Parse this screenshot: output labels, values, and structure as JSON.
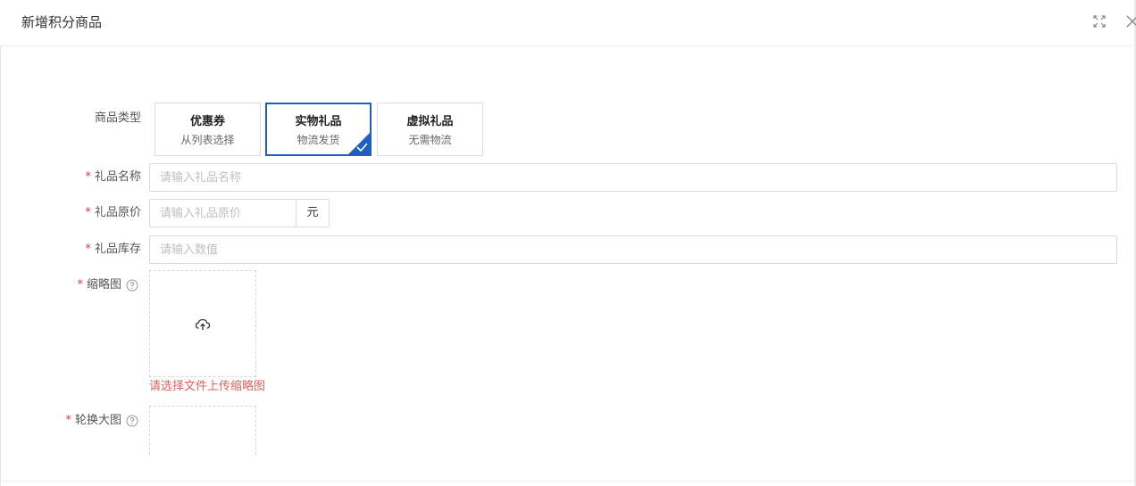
{
  "dialog": {
    "title": "新增积分商品"
  },
  "form": {
    "type_label": "商品类型",
    "types": [
      {
        "title": "优惠券",
        "sub": "从列表选择"
      },
      {
        "title": "实物礼品",
        "sub": "物流发货"
      },
      {
        "title": "虚拟礼品",
        "sub": "无需物流"
      }
    ],
    "required_mark": "*",
    "name_label": "礼品名称",
    "name_placeholder": "请输入礼品名称",
    "price_label": "礼品原价",
    "price_placeholder": "请输入礼品原价",
    "price_unit": "元",
    "stock_label": "礼品库存",
    "stock_placeholder": "请输入数值",
    "thumb_label": "缩略图",
    "thumb_error": "请选择文件上传缩略图",
    "carousel_label": "轮换大图"
  },
  "colors": {
    "accent": "#1e5fbf",
    "error": "#e06060",
    "required": "#e53935"
  }
}
